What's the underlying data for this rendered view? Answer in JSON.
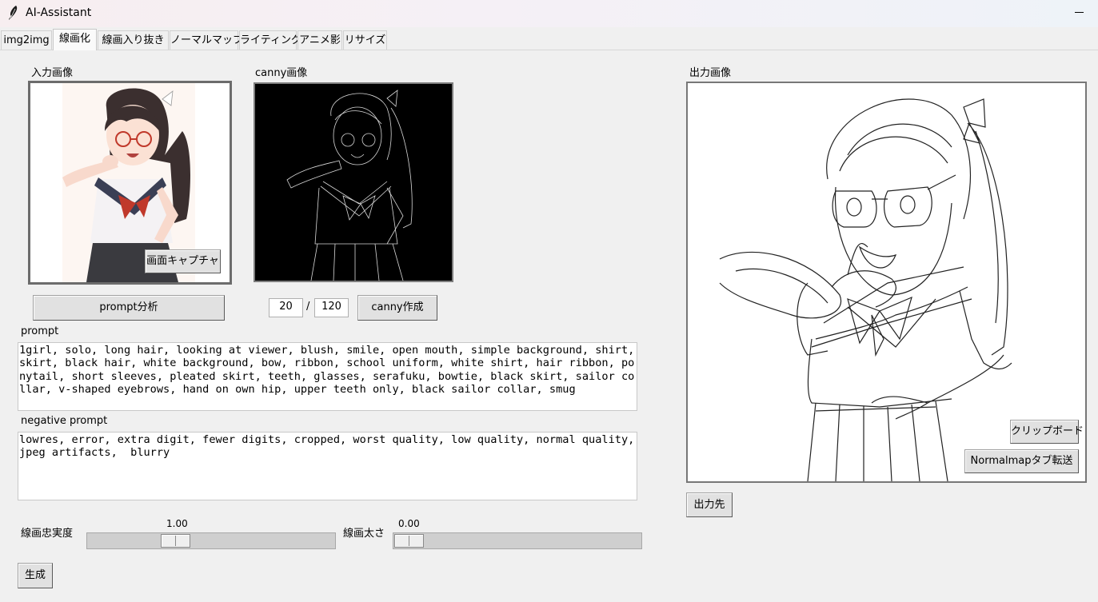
{
  "window": {
    "title": "AI-Assistant"
  },
  "tabs": [
    {
      "label": "img2img"
    },
    {
      "label": "線画化"
    },
    {
      "label": "線画入り抜き"
    },
    {
      "label": "ノーマルマップ"
    },
    {
      "label": "ライティング"
    },
    {
      "label": "アニメ影"
    },
    {
      "label": "リサイズ"
    }
  ],
  "active_tab": "線画化",
  "input_panel": {
    "label": "入力画像",
    "capture_button": "画面キャプチャ",
    "analyze_button": "prompt分析"
  },
  "canny_panel": {
    "label": "canny画像",
    "low_threshold": "20",
    "separator": "/",
    "high_threshold": "120",
    "create_button": "canny作成"
  },
  "prompt": {
    "label": "prompt",
    "value": "1girl, solo, long hair, looking at viewer, blush, smile, open mouth, simple background, shirt, skirt, black hair, white background, bow, ribbon, school uniform, white shirt, hair ribbon, ponytail, short sleeves, pleated skirt, teeth, glasses, serafuku, bowtie, black skirt, sailor collar, v-shaped eyebrows, hand on own hip, upper teeth only, black sailor collar, smug"
  },
  "negative_prompt": {
    "label": "negative prompt",
    "value": "lowres, error, extra digit, fewer digits, cropped, worst quality, low quality, normal quality, jpeg artifacts,  blurry"
  },
  "sliders": {
    "fidelity": {
      "label": "線画忠実度",
      "value": "1.00",
      "position": 0.25
    },
    "thickness": {
      "label": "線画太さ",
      "value": "0.00",
      "position": 0.0
    }
  },
  "generate_button": "生成",
  "output_panel": {
    "label": "出力画像",
    "clipboard_button": "クリップボード",
    "normalmap_button": "Normalmapタブ転送",
    "destination_button": "出力先"
  },
  "colors": {
    "background": "#f0f0f0",
    "canny_background": "#000000",
    "skirt": "#3a3a3f",
    "ribbon": "#c0392b"
  }
}
